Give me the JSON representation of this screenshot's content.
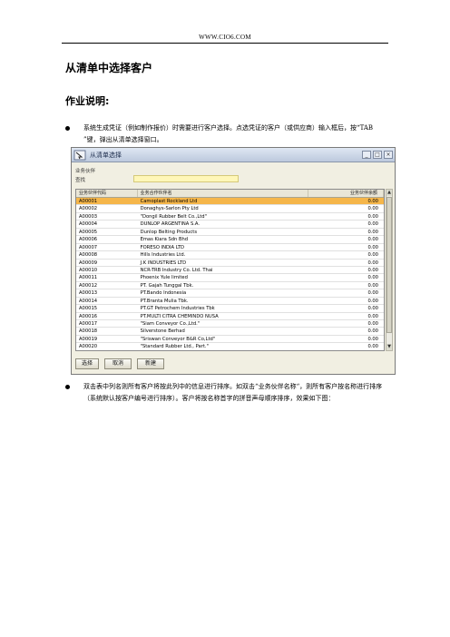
{
  "site_header": "WWW.CIO6.COM",
  "doc_title": "从清单中选择客户",
  "section_title": "作业说明:",
  "bullets": [
    "系统生成凭证（例如制作报价）时需要进行客户选择。点选凭证的客户（或供应商）输入框后，按“TAB ”键，弹出从清单选择窗口。",
    "双击表中列名则所有客户将按此列中的信息进行排序。如双击“业务伙伴名称“，则所有客户按名称进行排序（系统默认按客户编号进行排序）。客户将按名称首字的拼音声母顺序排序，效果如下图："
  ],
  "dialog": {
    "title": "从清单选择",
    "partner_label": "业务伙伴",
    "search_label": "查找",
    "search_value": "",
    "columns": [
      "业务伙伴代码",
      "业务合作伙伴名",
      "业务伙伴余额"
    ],
    "rows": [
      {
        "code": "A00001",
        "name": "Camoplast Rockland Ltd",
        "balance": "0.00",
        "selected": true
      },
      {
        "code": "A00002",
        "name": "Donaghys-Sarlon Pty Ltd",
        "balance": "0.00"
      },
      {
        "code": "A00003",
        "name": "\"Dongil Rubber Belt Co.,Ltd\"",
        "balance": "0.00"
      },
      {
        "code": "A00004",
        "name": "DUNLOP ARGENTINA S.A.",
        "balance": "0.00"
      },
      {
        "code": "A00005",
        "name": "Dunlop Belting Products",
        "balance": "0.00"
      },
      {
        "code": "A00006",
        "name": "Emas Kiara Sdn Bhd",
        "balance": "0.00"
      },
      {
        "code": "A00007",
        "name": "FORESO INDIA LTD",
        "balance": "0.00"
      },
      {
        "code": "A00008",
        "name": "Hills Industries Ltd.",
        "balance": "0.00"
      },
      {
        "code": "A00009",
        "name": "J.K INDUSTRIES LTD",
        "balance": "0.00"
      },
      {
        "code": "A00010",
        "name": "NCR-TRB Industry Co. Ltd. Thai",
        "balance": "0.00"
      },
      {
        "code": "A00011",
        "name": "Phoenix Yule limited",
        "balance": "0.00"
      },
      {
        "code": "A00012",
        "name": "PT. Gajah Tunggal Tbk.",
        "balance": "0.00"
      },
      {
        "code": "A00013",
        "name": "PT.Bando Indonesia",
        "balance": "0.00"
      },
      {
        "code": "A00014",
        "name": "PT.Branta Mulia Tbk.",
        "balance": "0.00"
      },
      {
        "code": "A00015",
        "name": "PT.GT Petrochem Industries Tbk",
        "balance": "0.00"
      },
      {
        "code": "A00016",
        "name": "PT.MULTI CITRA CHEMINDO NUSA",
        "balance": "0.00"
      },
      {
        "code": "A00017",
        "name": "\"Siam Conveyor Co.,Ltd.\"",
        "balance": "0.00"
      },
      {
        "code": "A00018",
        "name": "Silverstone Berhad",
        "balance": "0.00"
      },
      {
        "code": "A00019",
        "name": "\"Sriswan Conveyor B&R Co,Ltd\"",
        "balance": "0.00"
      },
      {
        "code": "A00020",
        "name": "\"Standard Rubber Ltd., Part.\"",
        "balance": "0.00"
      }
    ],
    "buttons": {
      "select": "选择",
      "cancel": "取消",
      "new": "新建"
    },
    "colors": {
      "selected_row": "#f5b64a",
      "search_field": "#fff7b8"
    }
  }
}
